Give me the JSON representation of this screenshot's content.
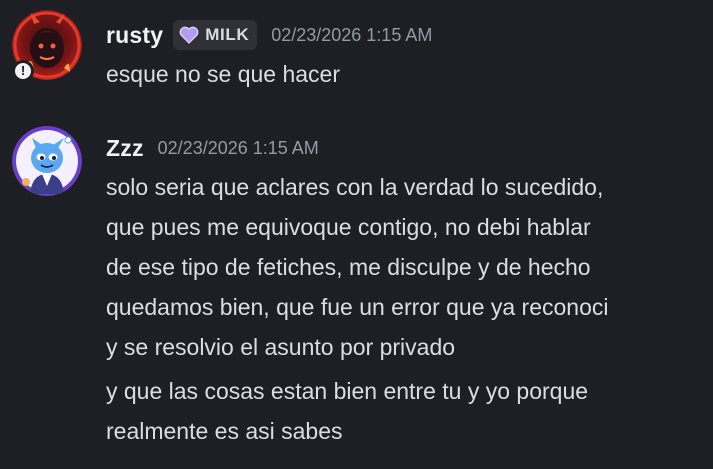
{
  "messages": [
    {
      "username": "rusty",
      "tag": {
        "label": "MILK",
        "icon": "purple-heart-icon",
        "color": "#b49cf0"
      },
      "timestamp": "02/23/2026 1:15 AM",
      "avatar_badge": "!",
      "avatar_icon": "red-devil-avatar-icon",
      "lines": [
        "esque no se que hacer"
      ]
    },
    {
      "username": "Zzz",
      "timestamp": "02/23/2026 1:15 AM",
      "avatar_icon": "blue-creature-avatar-icon",
      "lines": [
        "solo seria que aclares con la verdad lo sucedido,\nque pues me equivoque contigo, no debi hablar\nde ese tipo de fetiches, me disculpe y de hecho\nquedamos bien, que fue un error que ya reconoci\ny se resolvio el asunto por privado",
        "y que las cosas estan bien entre tu y yo porque\nrealmente es asi sabes"
      ]
    }
  ],
  "colors": {
    "background": "#1e1f24",
    "username": "#f2f3f5",
    "text": "#dbdee1",
    "timestamp": "#949ba4"
  }
}
